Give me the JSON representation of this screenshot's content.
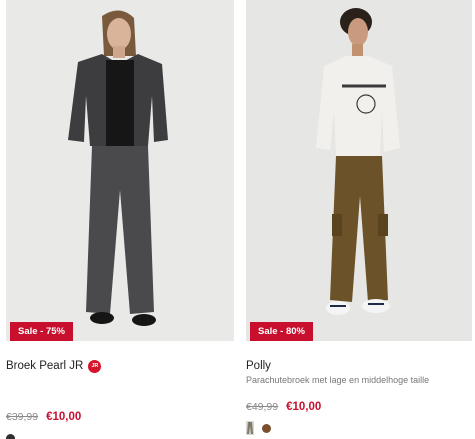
{
  "products": [
    {
      "name": "Broek Pearl JR",
      "badge_icon_text": "JR",
      "subtitle": "",
      "sale_label": "Sale - 75%",
      "old_price": "€39,99",
      "new_price": "€10,00",
      "colors": [
        "#2f2f2f"
      ]
    },
    {
      "name": "Polly",
      "subtitle": "Parachutebroek met lage en middelhoge taille",
      "sale_label": "Sale - 80%",
      "old_price": "€49,99",
      "new_price": "€10,00",
      "colors": [
        "#7d7a6b",
        "#7a4f2e"
      ]
    }
  ]
}
